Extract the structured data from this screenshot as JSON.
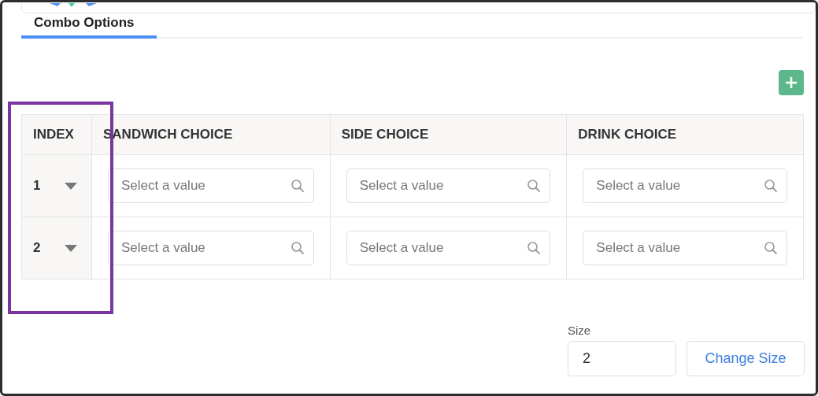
{
  "tabs": [
    {
      "label": "Combo Options",
      "selected": true
    }
  ],
  "table": {
    "columns": [
      "INDEX",
      "SANDWICH CHOICE",
      "SIDE CHOICE",
      "DRINK CHOICE"
    ],
    "rows": [
      {
        "cells": [
          {
            "kind": "index",
            "text": "1"
          },
          {
            "kind": "select",
            "placeholder": "Select a value"
          },
          {
            "kind": "select",
            "placeholder": "Select a value"
          },
          {
            "kind": "select",
            "placeholder": "Select a value"
          }
        ]
      },
      {
        "cells": [
          {
            "kind": "index",
            "text": "2"
          },
          {
            "kind": "select",
            "placeholder": "Select a value"
          },
          {
            "kind": "select",
            "placeholder": "Select a value"
          },
          {
            "kind": "select",
            "placeholder": "Select a value"
          }
        ]
      }
    ]
  },
  "size": {
    "label": "Size",
    "value": "2",
    "button": "Change Size"
  }
}
